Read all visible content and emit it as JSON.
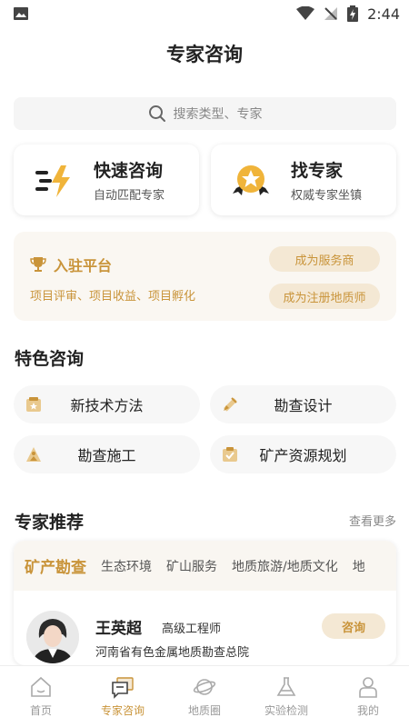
{
  "status": {
    "time": "2:44"
  },
  "page": {
    "title": "专家咨询"
  },
  "search": {
    "placeholder": "搜索类型、专家"
  },
  "quick_cards": [
    {
      "title": "快速咨询",
      "subtitle": "自动匹配专家",
      "icon": "lightning-icon"
    },
    {
      "title": "找专家",
      "subtitle": "权威专家坐镇",
      "icon": "medal-icon"
    }
  ],
  "platform": {
    "title": "入驻平台",
    "desc": "项目评审、项目收益、项目孵化",
    "btn1": "成为服务商",
    "btn2": "成为注册地质师"
  },
  "featured": {
    "title": "特色咨询",
    "items": [
      {
        "label": "新技术方法",
        "icon": "new-tech-icon"
      },
      {
        "label": "勘查设计",
        "icon": "design-icon"
      },
      {
        "label": "勘查施工",
        "icon": "construction-icon"
      },
      {
        "label": "矿产资源规划",
        "icon": "planning-icon"
      }
    ]
  },
  "experts": {
    "title": "专家推荐",
    "more": "查看更多",
    "tabs": [
      "矿产勘查",
      "生态环境",
      "矿山服务",
      "地质旅游/地质文化",
      "地"
    ],
    "card": {
      "name": "王英超",
      "title": "高级工程师",
      "org": "河南省有色金属地质勘查总院",
      "action": "咨询"
    }
  },
  "nav": [
    {
      "label": "首页",
      "icon": "home-icon"
    },
    {
      "label": "专家咨询",
      "icon": "chat-icon"
    },
    {
      "label": "地质圈",
      "icon": "planet-icon"
    },
    {
      "label": "实验检测",
      "icon": "flask-icon"
    },
    {
      "label": "我的",
      "icon": "user-icon"
    }
  ],
  "colors": {
    "accent": "#c9943a",
    "accent_bg": "#f4e8d4"
  }
}
